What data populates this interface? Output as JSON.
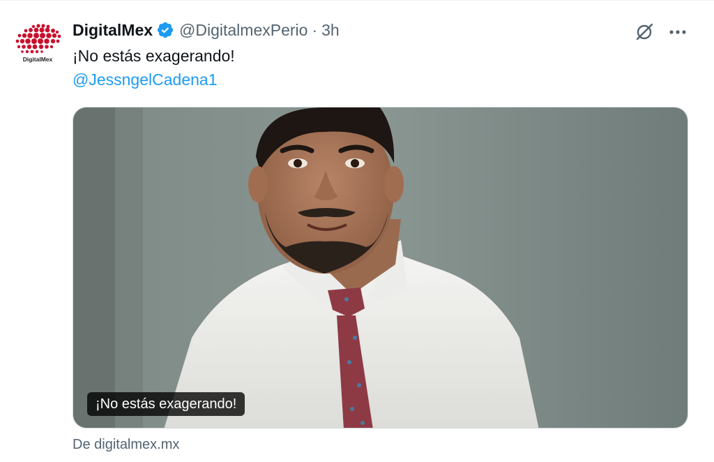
{
  "tweet": {
    "display_name": "DigitalMex",
    "handle": "@DigitalmexPerio",
    "separator": "·",
    "time": "3h",
    "text": "¡No estás exagerando!",
    "mention": "@JessngelCadena1",
    "media": {
      "caption": "¡No estás exagerando!",
      "source": "De digitalmex.mx"
    }
  },
  "avatar": {
    "logo_text": "DigitalMex"
  },
  "icons": {
    "verified": "verified-badge-icon",
    "grok": "grok-icon",
    "more": "more-horizontal-icon"
  },
  "colors": {
    "accent": "#1d9bf0",
    "text_primary": "#0f1419",
    "text_secondary": "#536471",
    "logo_red": "#c8102e"
  }
}
